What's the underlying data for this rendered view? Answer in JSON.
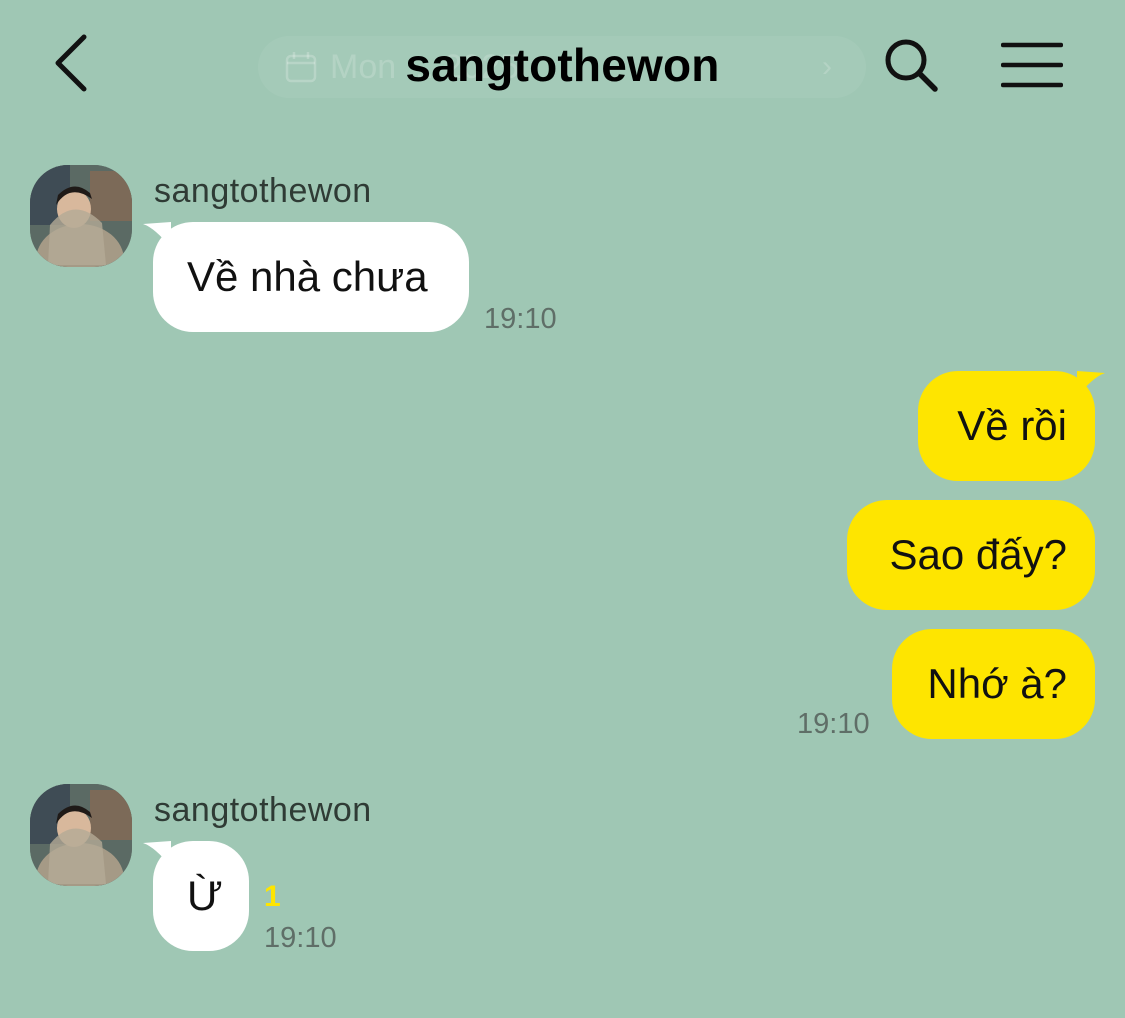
{
  "header": {
    "title": "sangtothewon",
    "date_pill": "Mon ... 2025",
    "back_icon": "chevron-left-icon",
    "search_icon": "search-icon",
    "menu_icon": "hamburger-menu-icon"
  },
  "colors": {
    "background": "#9fc7b4",
    "outgoing_bubble": "#fee500",
    "incoming_bubble": "#ffffff",
    "unread_count": "#fee500"
  },
  "messages": {
    "group1": {
      "sender": "sangtothewon",
      "text": "Về nhà chưa",
      "time": "19:10"
    },
    "group2": {
      "texts": [
        "Về rồi",
        "Sao đấy?",
        "Nhớ à?"
      ],
      "time": "19:10"
    },
    "group3": {
      "sender": "sangtothewon",
      "text": "Ừ",
      "unread": "1",
      "time": "19:10"
    }
  }
}
